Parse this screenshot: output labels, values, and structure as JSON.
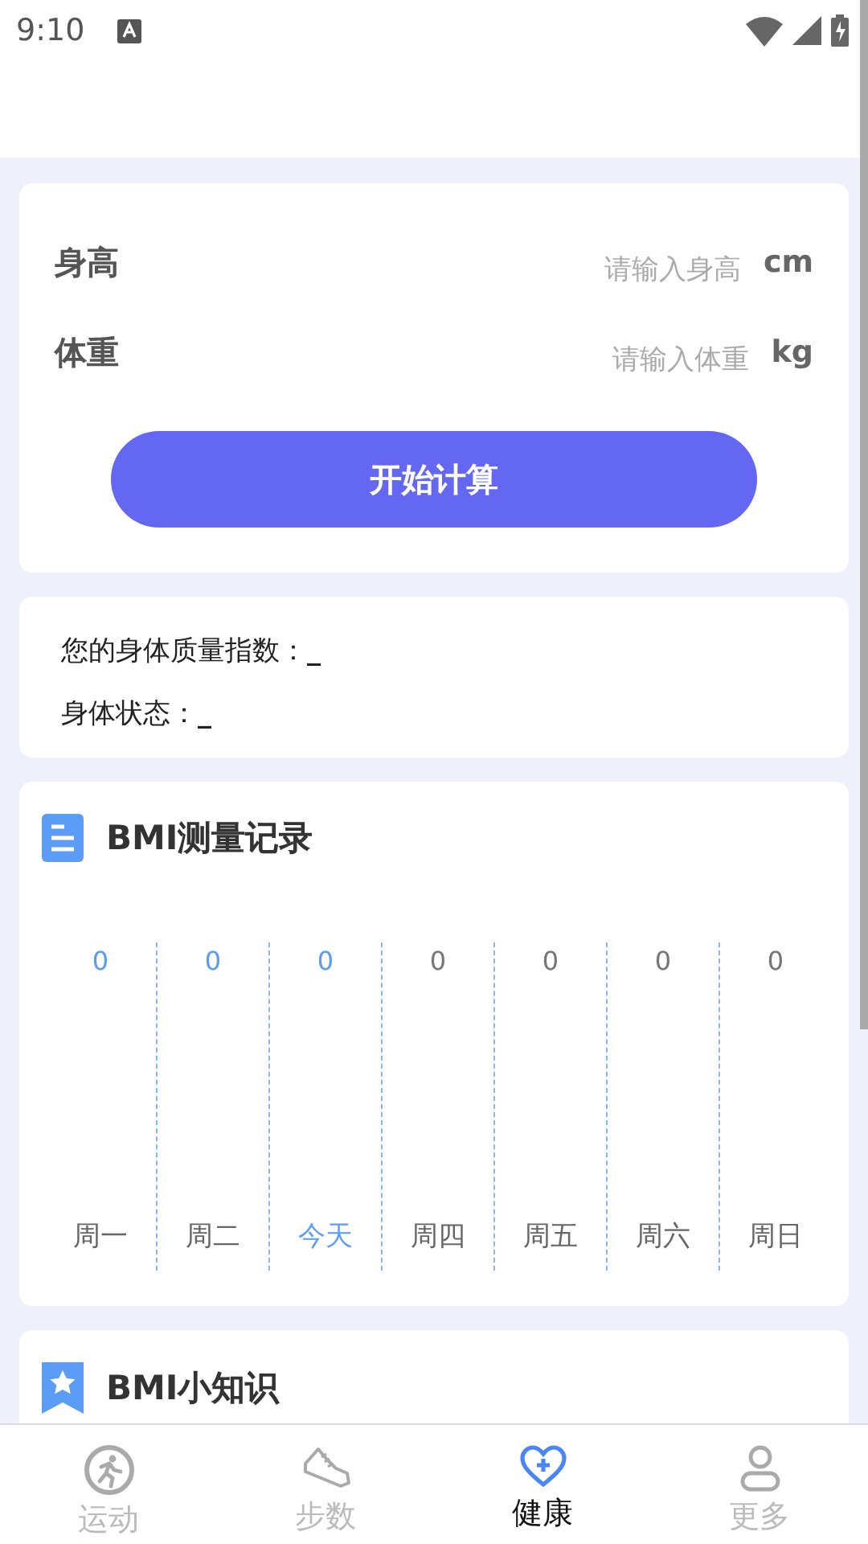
{
  "status_bar": {
    "time": "9:10"
  },
  "inputs": [
    {
      "label": "身高",
      "placeholder": "请输入身高",
      "unit": "cm"
    },
    {
      "label": "体重",
      "placeholder": "请输入体重",
      "unit": "kg"
    }
  ],
  "calculate_button": "开始计算",
  "result": [
    {
      "label": "您的身体质量指数：",
      "value": "_"
    },
    {
      "label": "身体状态：",
      "value": "_"
    }
  ],
  "record": {
    "title": "BMI测量记录",
    "days": [
      {
        "value": "0",
        "label": "周一",
        "kind": "past"
      },
      {
        "value": "0",
        "label": "周二",
        "kind": "past"
      },
      {
        "value": "0",
        "label": "今天",
        "kind": "today"
      },
      {
        "value": "0",
        "label": "周四",
        "kind": "future"
      },
      {
        "value": "0",
        "label": "周五",
        "kind": "future"
      },
      {
        "value": "0",
        "label": "周六",
        "kind": "future"
      },
      {
        "value": "0",
        "label": "周日",
        "kind": "future"
      }
    ]
  },
  "knowledge": {
    "title": "BMI小知识"
  },
  "tabs": [
    {
      "label": "运动",
      "kind": "run",
      "selected": false
    },
    {
      "label": "步数",
      "kind": "shoe",
      "selected": false
    },
    {
      "label": "健康",
      "kind": "heart",
      "selected": true
    },
    {
      "label": "更多",
      "kind": "person",
      "selected": false
    }
  ]
}
